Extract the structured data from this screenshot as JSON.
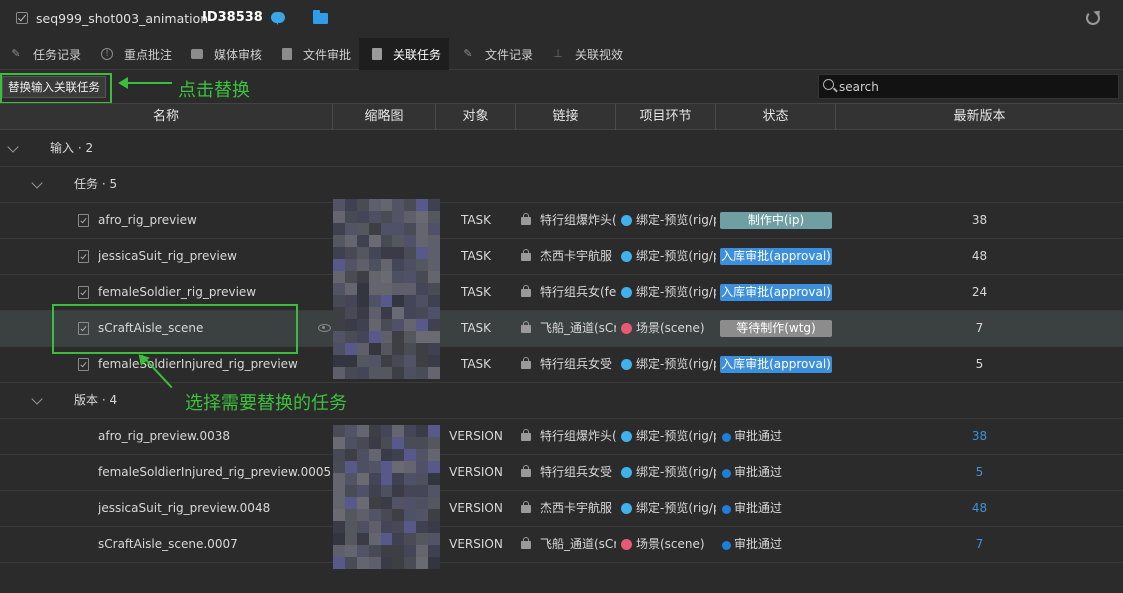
{
  "header": {
    "title": "seq999_shot003_animation",
    "id_label": "ID38538",
    "icons": [
      "checkbox-icon",
      "chat-icon",
      "folder-icon",
      "refresh-icon"
    ]
  },
  "tabs": [
    {
      "label": "任务记录",
      "icon": "pencil-icon",
      "active": false
    },
    {
      "label": "重点批注",
      "icon": "info-icon",
      "active": false
    },
    {
      "label": "媒体审核",
      "icon": "media-icon",
      "active": false
    },
    {
      "label": "文件审批",
      "icon": "file-icon",
      "active": false
    },
    {
      "label": "关联任务",
      "icon": "link-doc-icon",
      "active": true
    },
    {
      "label": "文件记录",
      "icon": "pencil-icon",
      "active": false
    },
    {
      "label": "关联视效",
      "icon": "fx-icon",
      "active": false
    }
  ],
  "toolbar": {
    "replace_button": "替换输入关联任务",
    "search_placeholder": "search"
  },
  "annotations": {
    "click_replace": "点击替换",
    "select_task": "选择需要替换的任务"
  },
  "columns": [
    "名称",
    "缩略图",
    "对象",
    "链接",
    "项目环节",
    "状态",
    "最新版本"
  ],
  "groups": {
    "input": "输入 · 2",
    "tasks": "任务 · 5",
    "versions": "版本 · 4"
  },
  "task_rows": [
    {
      "name": "afro_rig_preview",
      "object": "TASK",
      "link": "特行组爆炸头(",
      "stage": "绑定-预览(rig/p",
      "stage_color": "#3fb1ec",
      "status": "制作中(ip)",
      "status_color": "#6f9ea3",
      "version": "38",
      "selected": false
    },
    {
      "name": "jessicaSuit_rig_preview",
      "object": "TASK",
      "link": "杰西卡宇航服",
      "stage": "绑定-预览(rig/p",
      "stage_color": "#3fb1ec",
      "status": "入库审批(approval)",
      "status_color": "#3b8fdc",
      "version": "48",
      "selected": false
    },
    {
      "name": "femaleSoldier_rig_preview",
      "object": "TASK",
      "link": "特行组兵女(fe",
      "stage": "绑定-预览(rig/p",
      "stage_color": "#3fb1ec",
      "status": "入库审批(approval)",
      "status_color": "#3b8fdc",
      "version": "24",
      "selected": false
    },
    {
      "name": "sCraftAisle_scene",
      "object": "TASK",
      "link": "飞船_通道(sCra",
      "stage": "场景(scene)",
      "stage_color": "#e85a74",
      "status": "等待制作(wtg)",
      "status_color": "#8c8c8c",
      "version": "7",
      "selected": true
    },
    {
      "name": "femaleSoldierInjured_rig_preview",
      "object": "TASK",
      "link": "特行组兵女受",
      "stage": "绑定-预览(rig/p",
      "stage_color": "#3fb1ec",
      "status": "入库审批(approval)",
      "status_color": "#3b8fdc",
      "version": "5",
      "selected": false
    }
  ],
  "version_rows": [
    {
      "name": "afro_rig_preview.0038",
      "object": "VERSION",
      "link": "特行组爆炸头(",
      "stage": "绑定-预览(rig/p",
      "stage_color": "#3fb1ec",
      "status": "审批通过",
      "version": "38"
    },
    {
      "name": "femaleSoldierInjured_rig_preview.0005",
      "object": "VERSION",
      "link": "特行组兵女受",
      "stage": "绑定-预览(rig/p",
      "stage_color": "#3fb1ec",
      "status": "审批通过",
      "version": "5"
    },
    {
      "name": "jessicaSuit_rig_preview.0048",
      "object": "VERSION",
      "link": "杰西卡宇航服",
      "stage": "绑定-预览(rig/p",
      "stage_color": "#3fb1ec",
      "status": "审批通过",
      "version": "48"
    },
    {
      "name": "sCraftAisle_scene.0007",
      "object": "VERSION",
      "link": "飞船_通道(sCra",
      "stage": "场景(scene)",
      "stage_color": "#e85a74",
      "status": "审批通过",
      "version": "7"
    }
  ]
}
